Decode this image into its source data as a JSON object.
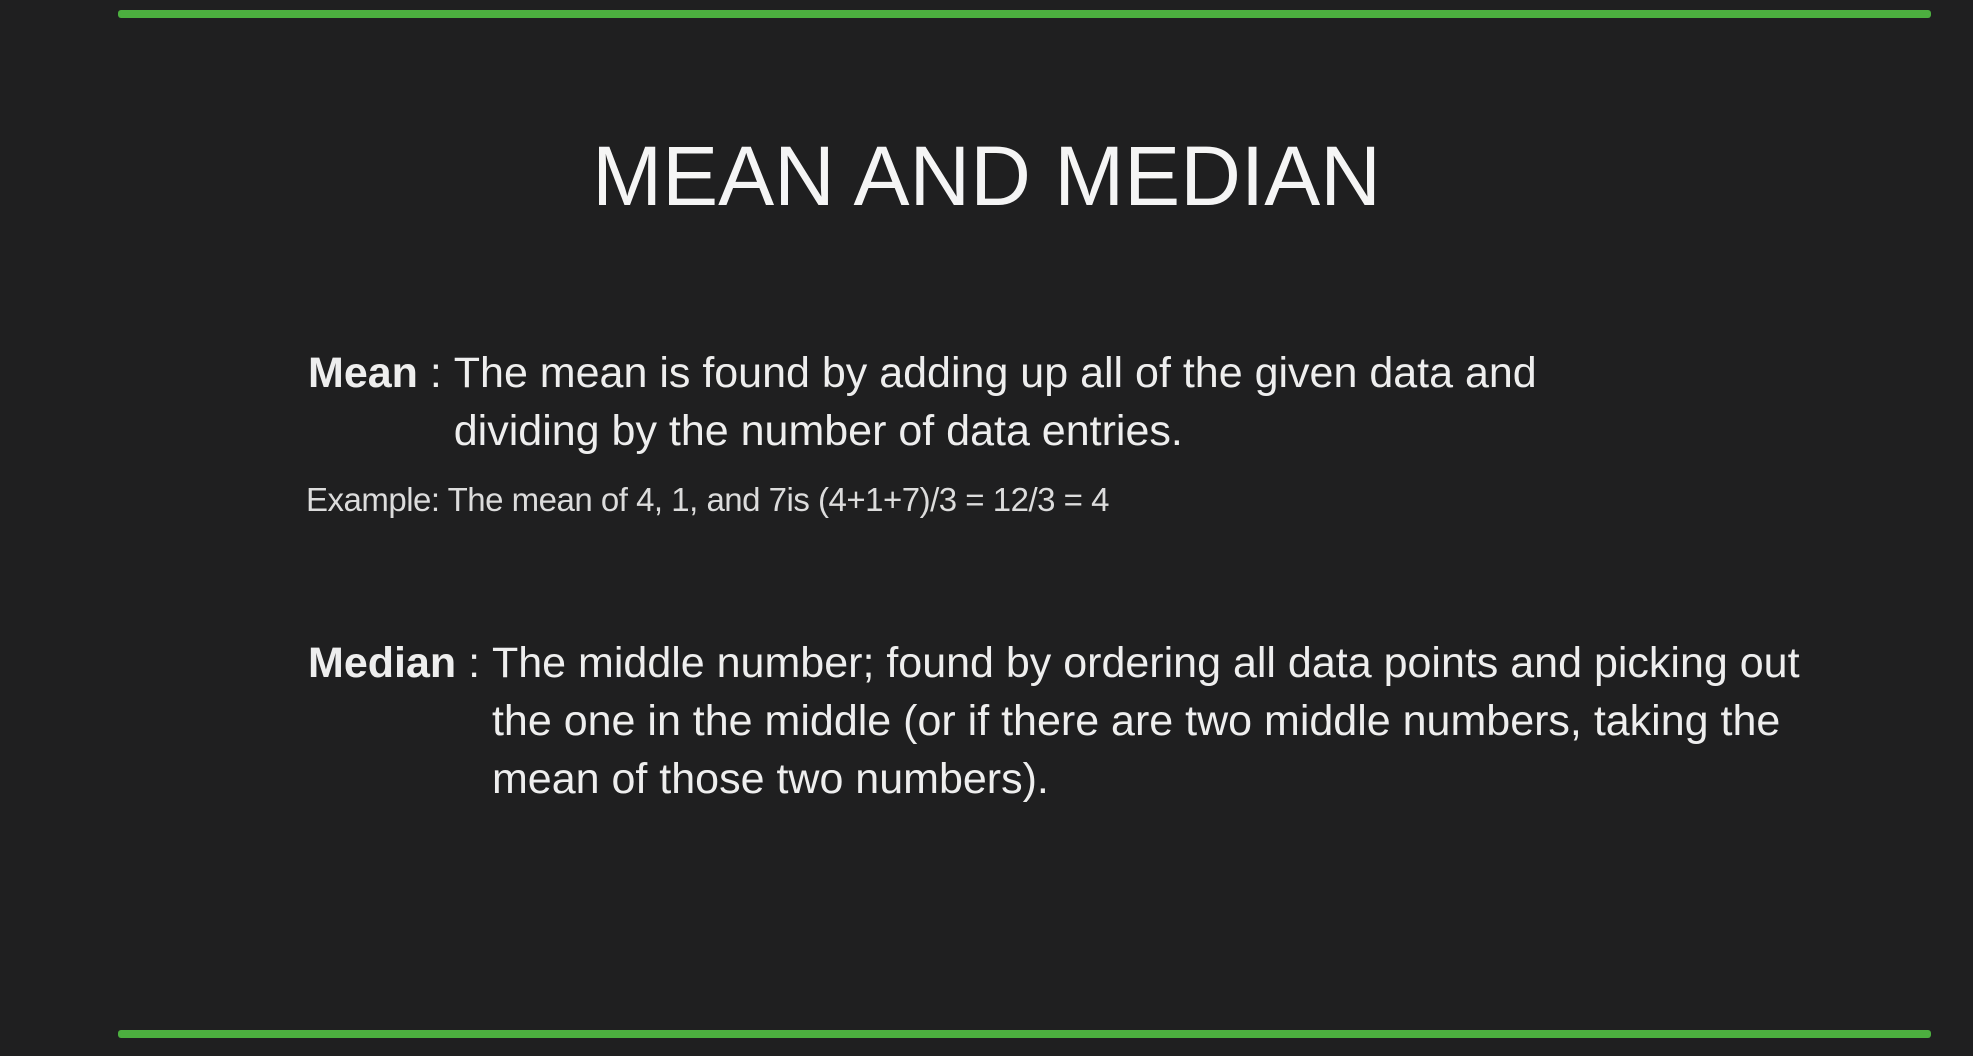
{
  "slide": {
    "title": "MEAN AND MEDIAN",
    "accent_color": "#4caf3f",
    "background_color": "#1f1f20",
    "mean": {
      "term": "Mean",
      "separator": " : ",
      "description": "The mean is found by adding up all of the given data and dividing by the number of data entries."
    },
    "example": "Example: The mean of 4, 1, and 7is (4+1+7)/3 = 12/3 = 4",
    "median": {
      "term": "Median",
      "separator": " : ",
      "description": "The middle number; found by ordering all data points and picking out the one in the middle (or if there are two middle numbers, taking the mean of those two numbers)."
    }
  }
}
